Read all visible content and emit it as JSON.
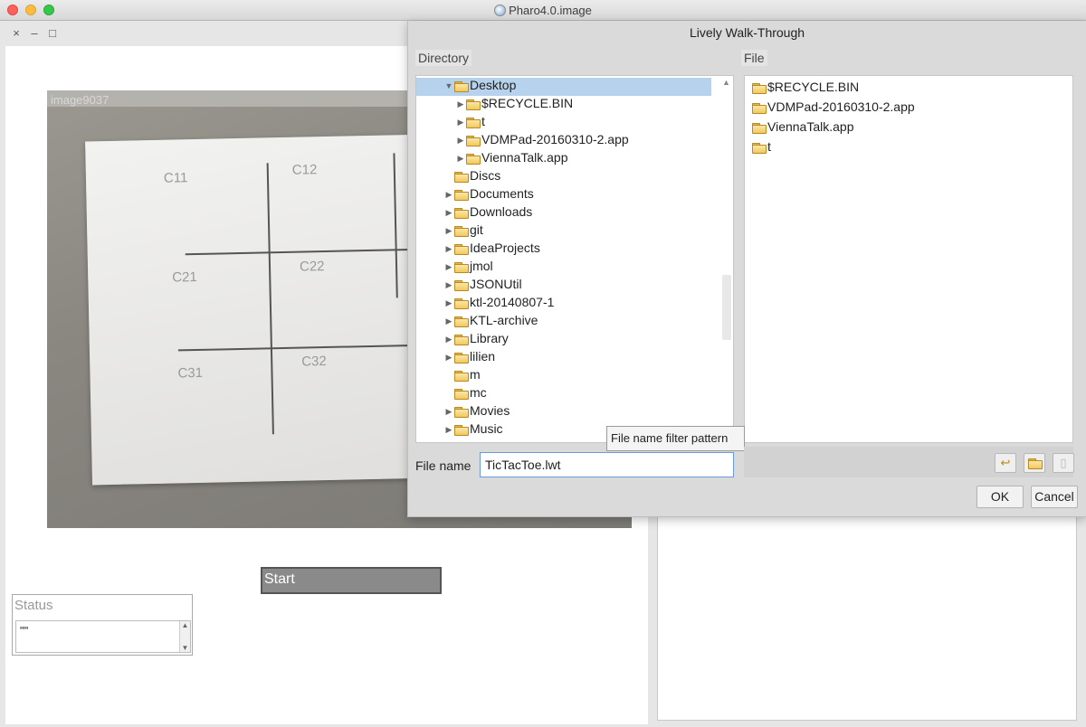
{
  "app": {
    "title": "Pharo4.0.image"
  },
  "world": {
    "window_controls": [
      "×",
      "–",
      "□"
    ],
    "image_label": "image9037",
    "grid_labels": [
      "C11",
      "C12",
      "C21",
      "C22",
      "C31",
      "C32"
    ],
    "start_label": "Start",
    "status": {
      "label": "Status",
      "value": "\"\""
    }
  },
  "dialog": {
    "title": "Lively Walk-Through",
    "directory_label": "Directory",
    "file_label": "File",
    "directory_items": [
      {
        "label": "Desktop",
        "expanded": true,
        "selected": true,
        "level": 0
      },
      {
        "label": "$RECYCLE.BIN",
        "level": 1,
        "arrow": true
      },
      {
        "label": "t",
        "level": 1,
        "arrow": true
      },
      {
        "label": "VDMPad-20160310-2.app",
        "level": 1,
        "arrow": true
      },
      {
        "label": "ViennaTalk.app",
        "level": 1,
        "arrow": true
      },
      {
        "label": "Discs",
        "level": 0,
        "arrow": false
      },
      {
        "label": "Documents",
        "level": 0,
        "arrow": true
      },
      {
        "label": "Downloads",
        "level": 0,
        "arrow": true
      },
      {
        "label": "git",
        "level": 0,
        "arrow": true
      },
      {
        "label": "IdeaProjects",
        "level": 0,
        "arrow": true
      },
      {
        "label": "jmol",
        "level": 0,
        "arrow": true
      },
      {
        "label": "JSONUtil",
        "level": 0,
        "arrow": true
      },
      {
        "label": "ktl-20140807-1",
        "level": 0,
        "arrow": true
      },
      {
        "label": "KTL-archive",
        "level": 0,
        "arrow": true
      },
      {
        "label": "Library",
        "level": 0,
        "arrow": true
      },
      {
        "label": "lilien",
        "level": 0,
        "arrow": true
      },
      {
        "label": "m",
        "level": 0,
        "arrow": false
      },
      {
        "label": "mc",
        "level": 0,
        "arrow": false
      },
      {
        "label": "Movies",
        "level": 0,
        "arrow": true
      },
      {
        "label": "Music",
        "level": 0,
        "arrow": true
      }
    ],
    "file_items": [
      "$RECYCLE.BIN",
      "VDMPad-20160310-2.app",
      "ViennaTalk.app",
      "t"
    ],
    "file_name_label": "File name",
    "file_name_value": "TicTacToe.lwt",
    "tooltip": "File name filter pattern",
    "ok_label": "OK",
    "cancel_label": "Cancel"
  }
}
